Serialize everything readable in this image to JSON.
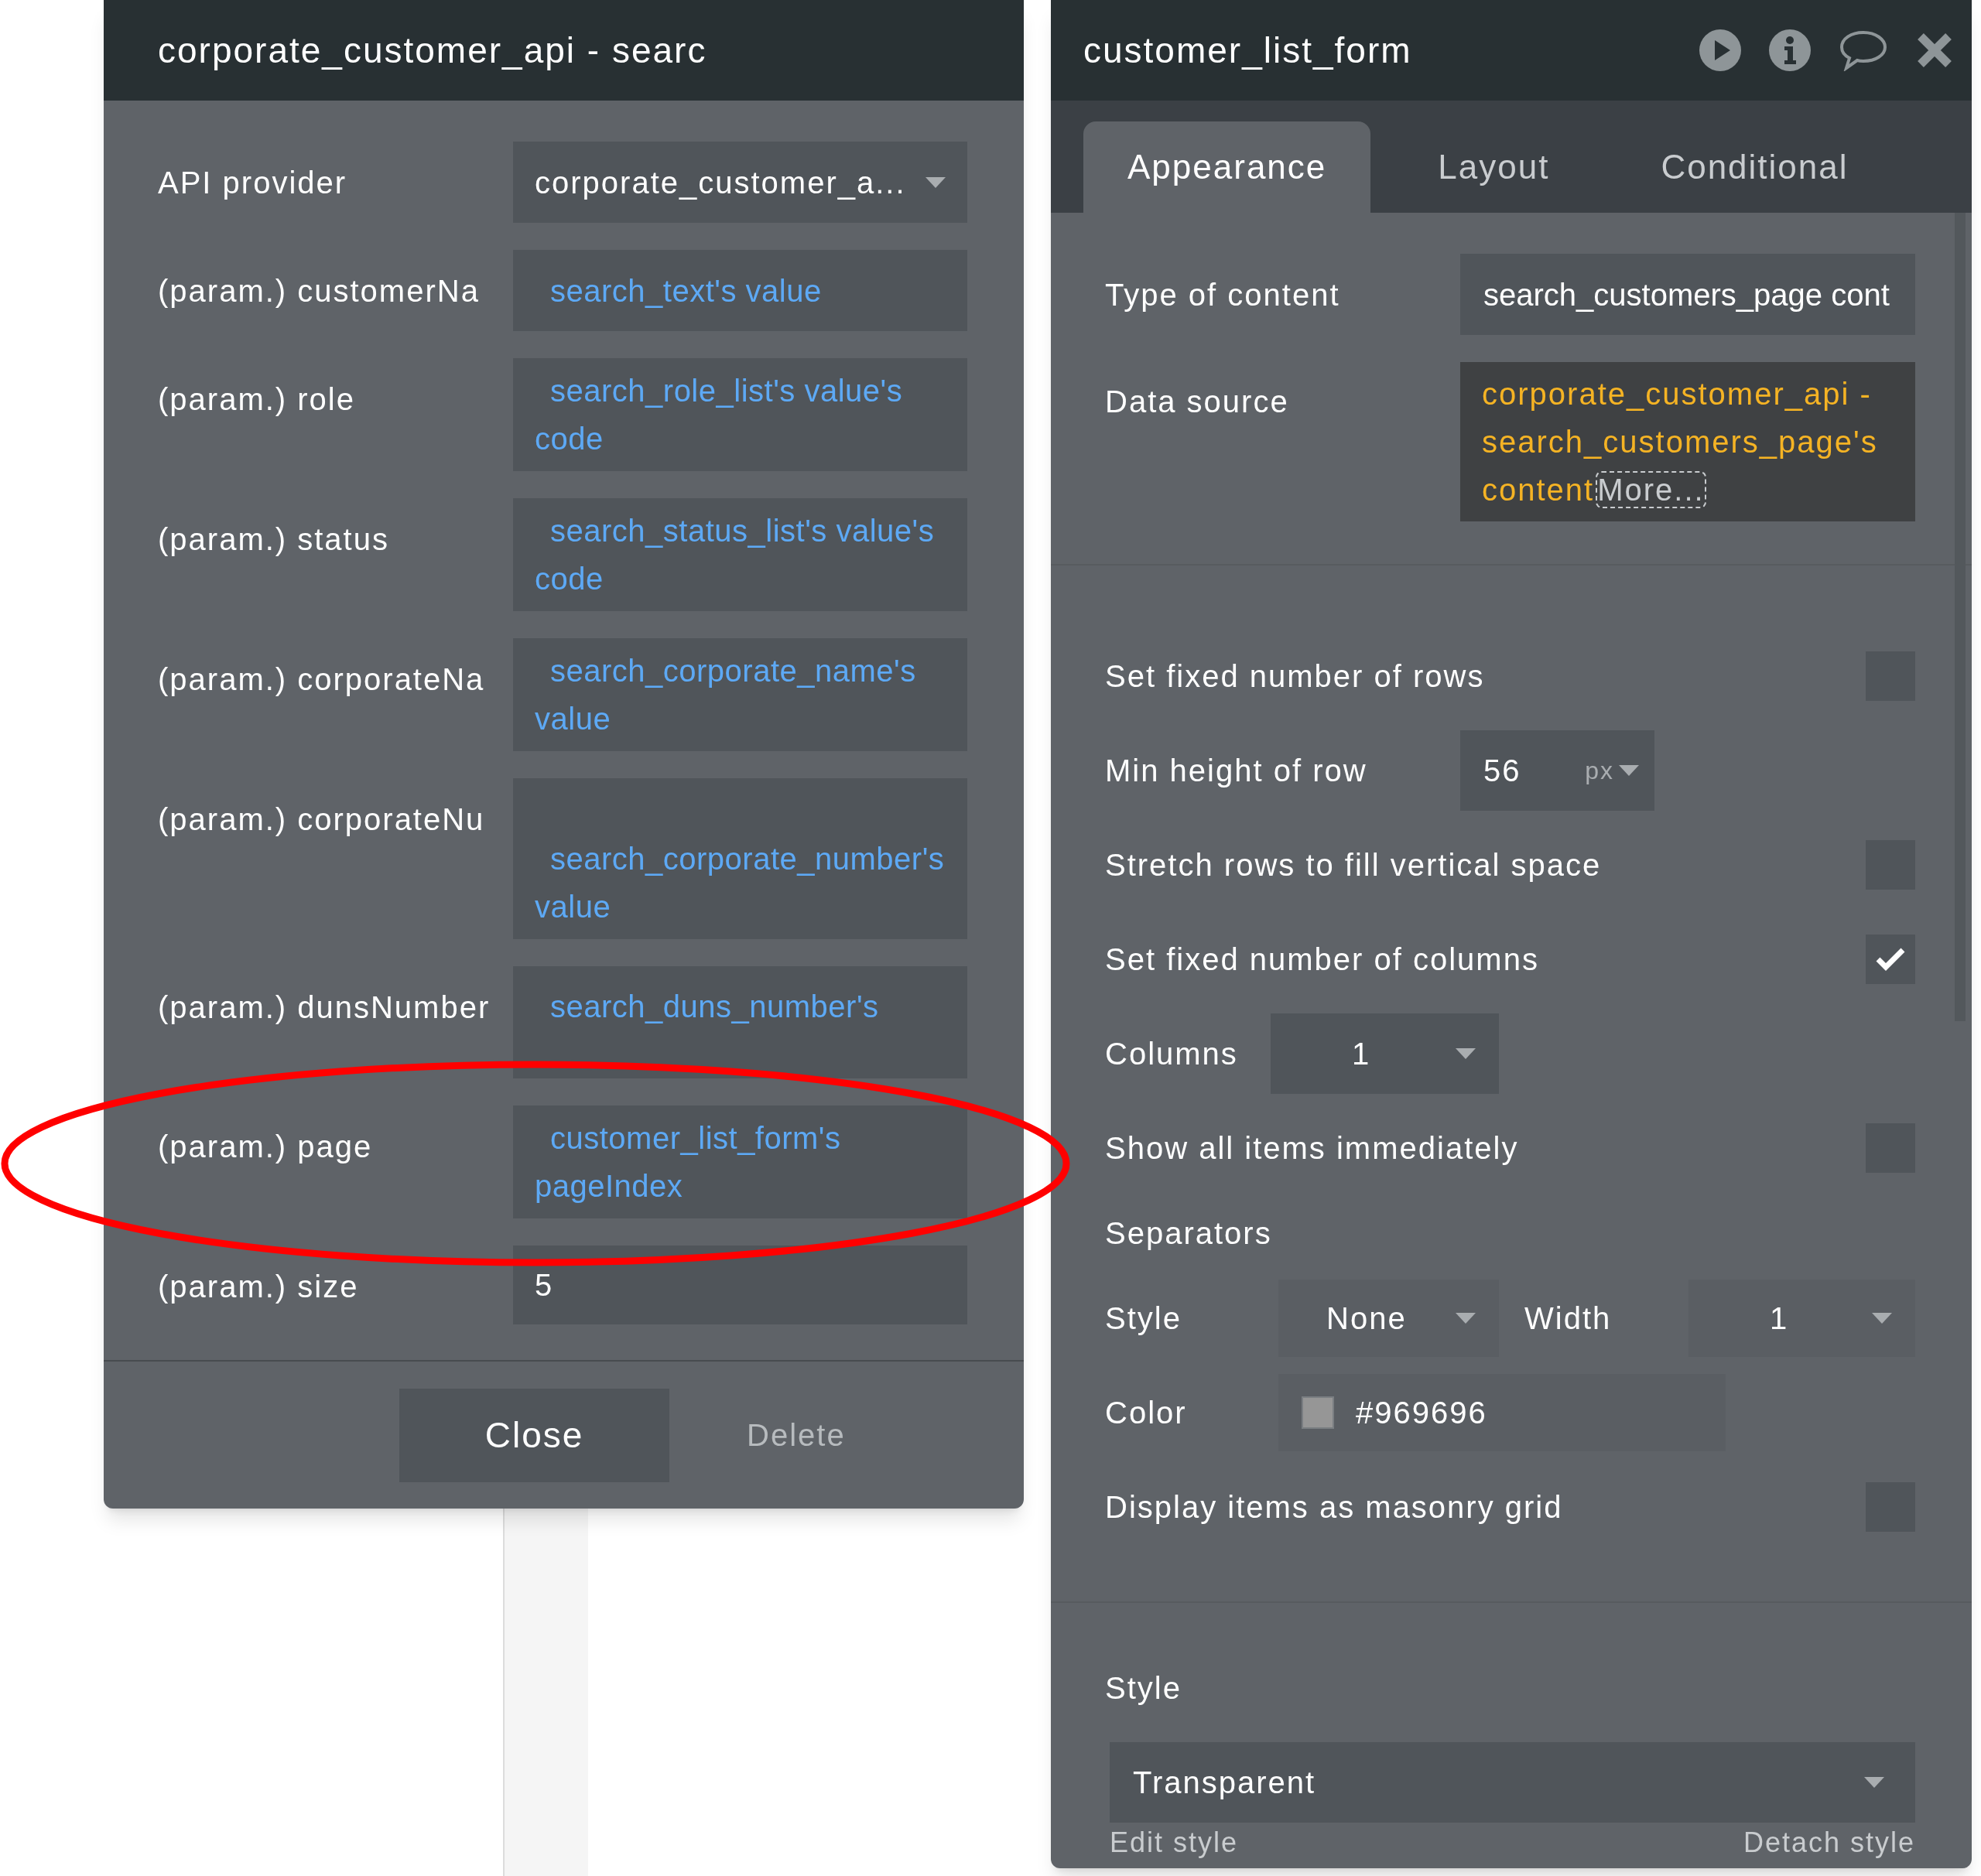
{
  "left_panel": {
    "title": "corporate_customer_api - searc",
    "fields": [
      {
        "label": "API provider",
        "kind": "dropdown",
        "value": "corporate_customer_a..."
      },
      {
        "label": "(param.) customerNa",
        "kind": "expression",
        "value": "search_text's value"
      },
      {
        "label": "(param.) role",
        "kind": "expression",
        "value": "search_role_list's value's code"
      },
      {
        "label": "(param.) status",
        "kind": "expression",
        "value": "search_status_list's value's code"
      },
      {
        "label": "(param.) corporateNa",
        "kind": "expression",
        "value": "search_corporate_name's value"
      },
      {
        "label": "(param.) corporateNu",
        "kind": "expression",
        "value": "search_corporate_number's value"
      },
      {
        "label": "(param.) dunsNumber",
        "kind": "expression",
        "value": "search_duns_number's"
      },
      {
        "label": "(param.) page",
        "kind": "expression",
        "value": "customer_list_form's pageIndex"
      },
      {
        "label": "(param.) size",
        "kind": "text",
        "value": "5"
      }
    ],
    "buttons": [
      {
        "label": "Close",
        "kind": "primary"
      },
      {
        "label": "Delete",
        "kind": "secondary"
      }
    ]
  },
  "right_panel": {
    "title": "customer_list_form",
    "tabs": [
      {
        "label": "Appearance",
        "selected": true
      },
      {
        "label": "Layout",
        "selected": false
      },
      {
        "label": "Conditional",
        "selected": false
      }
    ],
    "sections": [
      {
        "rows": [
          {
            "kind": "dropdown",
            "label": "Type of content",
            "value": "search_customers_page cont"
          },
          {
            "kind": "expression",
            "label": "Data source",
            "value": "corporate_customer_api - search_customers_page's content",
            "more": "More..."
          }
        ]
      },
      {
        "rows": [
          {
            "kind": "checkbox",
            "label": "Set fixed number of rows",
            "checked": false
          },
          {
            "kind": "unit_input",
            "label": "Min height of row",
            "value": "56",
            "unit": "px"
          },
          {
            "kind": "checkbox",
            "label": "Stretch rows to fill vertical space",
            "checked": false
          },
          {
            "kind": "checkbox",
            "label": "Set fixed number of columns",
            "checked": true
          },
          {
            "kind": "select",
            "label": "Columns",
            "value": "1"
          },
          {
            "kind": "checkbox",
            "label": "Show all items immediately",
            "checked": false
          },
          {
            "kind": "heading",
            "label": "Separators"
          },
          {
            "kind": "pair",
            "label": "Style",
            "value": "None",
            "label2": "Width",
            "value2": "1"
          },
          {
            "kind": "color",
            "label": "Color",
            "value": "#969696",
            "color": "#969696"
          },
          {
            "kind": "checkbox",
            "label": "Display items as masonry grid",
            "checked": false
          }
        ]
      },
      {
        "rows": [
          {
            "kind": "heading",
            "label": "Style"
          },
          {
            "kind": "style_dropdown",
            "value": "Transparent"
          },
          {
            "kind": "links",
            "label": "Edit style",
            "label2": "Detach style"
          }
        ]
      }
    ]
  }
}
